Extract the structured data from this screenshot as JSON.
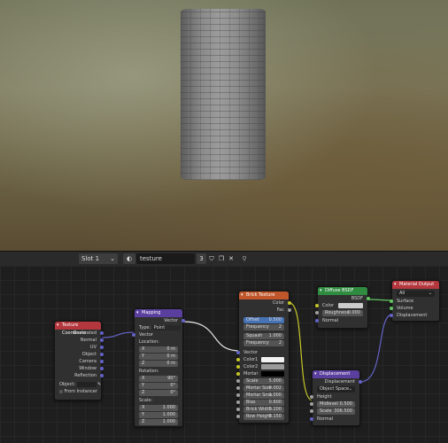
{
  "toolbar": {
    "slot": "Slot 1",
    "material_name": "testure",
    "user_count": "3"
  },
  "colors": {
    "input_header": "#b3373d",
    "vector_header": "#5a3f9e",
    "texture_header": "#c0572b",
    "shader_header": "#2e8b3f",
    "output_header": "#b3373d",
    "socket_vector": "#6363c7",
    "socket_color": "#c7c729",
    "socket_float": "#a1a1a1",
    "socket_shader": "#63c763"
  },
  "nodes": {
    "texcoord": {
      "title": "Texture Coordinate",
      "outputs": [
        "Generated",
        "Normal",
        "UV",
        "Object",
        "Camera",
        "Window",
        "Reflection"
      ],
      "object_label": "Object:",
      "from_instancer": "From Instancer"
    },
    "mapping": {
      "title": "Mapping",
      "out_vector": "Vector",
      "type_label": "Type:",
      "type_value": "Point",
      "in_vector": "Vector",
      "location_label": "Location:",
      "location": [
        {
          "axis": "X",
          "value": "0 m"
        },
        {
          "axis": "Y",
          "value": "0 m"
        },
        {
          "axis": "Z",
          "value": "0 m"
        }
      ],
      "rotation_label": "Rotation:",
      "rotation": [
        {
          "axis": "X",
          "value": "90°"
        },
        {
          "axis": "Y",
          "value": "0°"
        },
        {
          "axis": "Z",
          "value": "0°"
        }
      ],
      "scale_label": "Scale:",
      "scale": [
        {
          "axis": "X",
          "value": "1.000"
        },
        {
          "axis": "Y",
          "value": "1.000"
        },
        {
          "axis": "Z",
          "value": "1.000"
        }
      ]
    },
    "brick": {
      "title": "Brick Texture",
      "out_color": "Color",
      "out_fac": "Fac",
      "offset_label": "Offset",
      "offset_value": "0.500",
      "frequency1_label": "Frequency",
      "frequency1_value": "2",
      "squash_label": "Squash",
      "squash_value": "1.000",
      "frequency2_label": "Frequency",
      "frequency2_value": "2",
      "in_vector": "Vector",
      "color1": "Color1",
      "color2": "Color2",
      "mortar": "Mortar",
      "fields": [
        {
          "label": "Scale",
          "value": "5.000"
        },
        {
          "label": "Mortar Size",
          "value": "0.002"
        },
        {
          "label": "Mortar Smo",
          "value": "1.000"
        },
        {
          "label": "Bias",
          "value": "0.600"
        },
        {
          "label": "Brick Width",
          "value": "0.200"
        },
        {
          "label": "Row Height",
          "value": "0.150"
        }
      ]
    },
    "diffuse": {
      "title": "Diffuse BSDF",
      "out_bsdf": "BSDF",
      "color": "Color",
      "roughness_label": "Roughness",
      "roughness_value": "0.000",
      "normal": "Normal"
    },
    "output": {
      "title": "Material Output",
      "target": "All",
      "surface": "Surface",
      "volume": "Volume",
      "displacement": "Displacement"
    },
    "displacement": {
      "title": "Displacement",
      "out_displacement": "Displacement",
      "space": "Object Space",
      "height": "Height",
      "midlevel_label": "Midlevel",
      "midlevel_value": "0.500",
      "scale_label": "Scale",
      "scale_value": "306.500",
      "normal": "Normal"
    }
  }
}
